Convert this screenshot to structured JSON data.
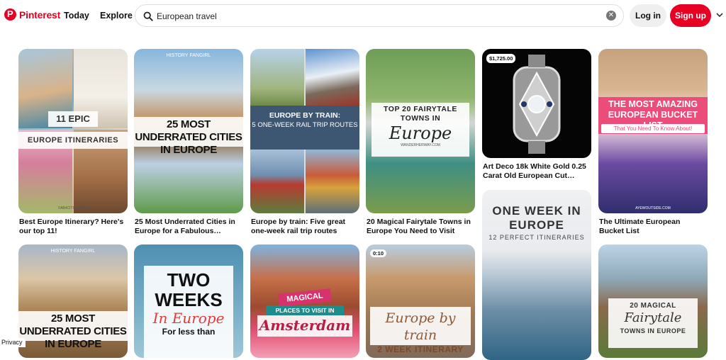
{
  "header": {
    "brand": "Pinterest",
    "nav": [
      "Today",
      "Explore"
    ],
    "search_value": "European travel",
    "login_label": "Log in",
    "signup_label": "Sign up"
  },
  "pins": [
    {
      "title": "Best Europe Itinerary? Here's our top 11!",
      "overlay_top": "11 EPIC",
      "overlay_bottom": "EUROPE ITINERARIES",
      "watermark": "FAB4CITIES.COM"
    },
    {
      "title": "25 Most Underrated Cities in Europe for a Fabulous…",
      "overlay_top": "HISTORY FANGIRL",
      "overlay_bottom": "25 MOST UNDERRATED CITIES IN EUROPE"
    },
    {
      "title": "Europe by train: Five great one-week rail trip routes",
      "overlay_line1": "EUROPE BY TRAIN:",
      "overlay_line2": "5 ONE-WEEK RAIL TRIP ROUTES"
    },
    {
      "title": "20 Magical Fairytale Towns in Europe You Need to Visit",
      "overlay_line1": "TOP 20 FAIRYTALE TOWNS IN",
      "overlay_script": "Europe",
      "watermark": "WANDERHERWAY.COM"
    },
    {
      "title": "Art Deco 18k White Gold 0.25 Carat Old European Cut…",
      "price": "$1,725.00"
    },
    {
      "title": "The Ultimate European Bucket List",
      "overlay_line1": "THE MOST AMAZING EUROPEAN BUCKET LIST",
      "overlay_line2": "That You Need To Know About!",
      "watermark": "AYEWOUTSIDE.COM"
    },
    {
      "overlay_top": "HISTORY FANGIRL",
      "overlay_bottom": "25 MOST UNDERRATED CITIES IN EUROPE"
    },
    {
      "overlay_line1": "TWO WEEKS",
      "overlay_script": "In Europe",
      "overlay_line3": "For less than"
    },
    {
      "overlay_line1": "MAGICAL",
      "overlay_line2": "PLACES TO VISIT IN",
      "overlay_script": "Amsterdam"
    },
    {
      "duration": "0:10",
      "overlay_script": "Europe by train",
      "overlay_line2": "2 WEEK ITINERARY"
    },
    {
      "overlay_line1": "ONE WEEK IN EUROPE",
      "overlay_line2": "12 PERFECT ITINERARIES"
    },
    {
      "overlay_line1": "20 MAGICAL",
      "overlay_script": "Fairytale",
      "overlay_line3": "TOWNS IN EUROPE"
    }
  ],
  "footer": {
    "privacy": "Privacy"
  }
}
